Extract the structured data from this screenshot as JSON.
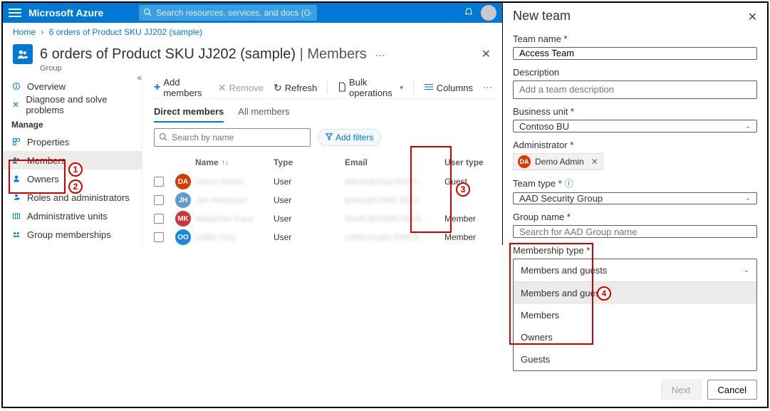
{
  "topbar": {
    "brand": "Microsoft Azure",
    "search_placeholder": "Search resources, services, and docs (G+/)"
  },
  "breadcrumb": {
    "home": "Home",
    "current": "6 orders of Product SKU JJ202 (sample)"
  },
  "page": {
    "title": "6 orders of Product SKU JJ202 (sample)",
    "section": "Members",
    "subtype": "Group"
  },
  "sidebar": {
    "overview": "Overview",
    "diagnose": "Diagnose and solve problems",
    "manage_header": "Manage",
    "properties": "Properties",
    "members": "Members",
    "owners": "Owners",
    "roles": "Roles and administrators",
    "admin_units": "Administrative units",
    "group_memberships": "Group memberships"
  },
  "toolbar": {
    "add_members": "Add members",
    "remove": "Remove",
    "refresh": "Refresh",
    "bulk": "Bulk operations",
    "columns": "Columns"
  },
  "tabs": {
    "direct": "Direct members",
    "all": "All members"
  },
  "filters": {
    "search_placeholder": "Search by name",
    "add_filters": "Add filters"
  },
  "table": {
    "headers": {
      "name": "Name",
      "type": "Type",
      "email": "Email",
      "user_type": "User type"
    },
    "rows": [
      {
        "initials": "DA",
        "color": "#d83b01",
        "name": "Demo Admin",
        "type": "User",
        "email": "admin@msp76372...",
        "user_type": "Guest"
      },
      {
        "initials": "JH",
        "color": "#5c9bd4",
        "name": "Jim Holtzman",
        "type": "User",
        "email": "jimho@CRMC3Onl...",
        "user_type": ""
      },
      {
        "initials": "MK",
        "color": "#d13438",
        "name": "Manjinder Kaur",
        "type": "User",
        "email": "ManK@CRMC3Onli...",
        "user_type": "Member"
      },
      {
        "initials": "OO",
        "color": "#1a88e0",
        "name": "O365 Only",
        "type": "User",
        "email": "o365only@CRMC3...",
        "user_type": "Member"
      }
    ]
  },
  "annotations": {
    "n1": "1",
    "n2": "2",
    "n3": "3",
    "n4": "4"
  },
  "panel": {
    "title": "New team",
    "labels": {
      "team_name": "Team name",
      "description": "Description",
      "business_unit": "Business unit",
      "administrator": "Administrator",
      "team_type": "Team type",
      "group_name": "Group name",
      "membership_type": "Membership type"
    },
    "values": {
      "team_name": "Access Team",
      "description_placeholder": "Add a team description",
      "business_unit": "Contoso BU",
      "admin_name": "Demo Admin",
      "admin_initials": "DA",
      "team_type": "AAD Security Group",
      "group_name_placeholder": "Search for AAD Group name",
      "membership_selected": "Members and guests"
    },
    "membership_options": [
      "Members and guests",
      "Members",
      "Owners",
      "Guests"
    ],
    "buttons": {
      "next": "Next",
      "cancel": "Cancel"
    }
  }
}
